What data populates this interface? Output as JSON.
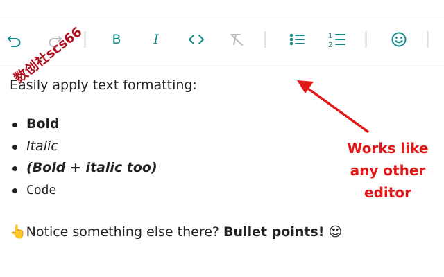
{
  "toolbar": {
    "buttons": [
      {
        "name": "undo",
        "icon": "undo-icon"
      },
      {
        "name": "redo",
        "icon": "redo-icon"
      },
      {
        "name": "bold",
        "label": "B"
      },
      {
        "name": "italic",
        "label": "I"
      },
      {
        "name": "code",
        "label": "<>"
      },
      {
        "name": "clear-format",
        "icon": "clear-format-icon"
      },
      {
        "name": "bullet-list",
        "icon": "bullet-list-icon"
      },
      {
        "name": "numbered-list",
        "icon": "numbered-list-icon"
      },
      {
        "name": "emoji",
        "icon": "smiley-icon"
      }
    ],
    "accent_color": "#138b87",
    "disabled_color": "#b9bcbc"
  },
  "editor": {
    "intro": "Easily apply text formatting:",
    "list": [
      {
        "text": "Bold",
        "style": "bold"
      },
      {
        "text": "Italic",
        "style": "italic"
      },
      {
        "text": "(Bold + italic too)",
        "style": "bold-italic"
      },
      {
        "text": "Code",
        "style": "code"
      }
    ],
    "notice_emoji": "👆",
    "notice_text": "Notice something else there? ",
    "notice_bold": "Bullet points!",
    "notice_end_emoji": "😍"
  },
  "annotation": {
    "lines": [
      "Works like",
      "any other",
      "editor"
    ],
    "color": "#e01818"
  },
  "watermark": {
    "text": "数创社scs66"
  }
}
